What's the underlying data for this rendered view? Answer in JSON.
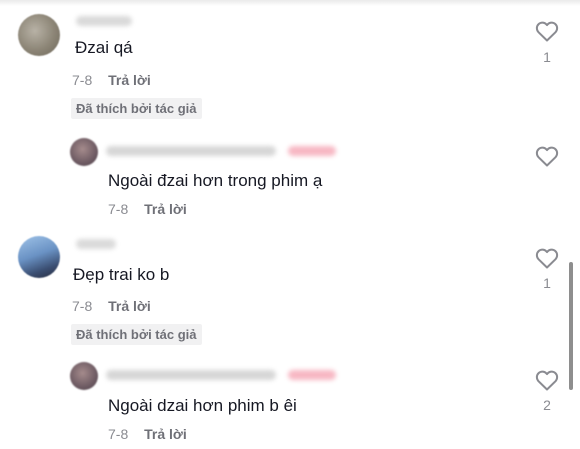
{
  "comments": [
    {
      "text": "Đzai qá",
      "date": "7-8",
      "reply_label": "Trả lời",
      "liked_badge": "Đã thích bởi tác giả",
      "like_count": "1",
      "reply": {
        "text": "Ngoài đzai hơn trong phim ạ",
        "date": "7-8",
        "reply_label": "Trả lời"
      }
    },
    {
      "text": "Đẹp trai ko b",
      "date": "7-8",
      "reply_label": "Trả lời",
      "liked_badge": "Đã thích bởi tác giả",
      "like_count": "1",
      "reply": {
        "text": "Ngoài dzai hơn phim b êi",
        "date": "7-8",
        "reply_label": "Trả lời",
        "like_count": "2"
      }
    }
  ],
  "colors": {
    "text_primary": "#161823",
    "text_secondary": "#8a8b91",
    "badge_bg": "#f1f1f2",
    "author_tag_pink": "#fe2c55"
  },
  "icons": {
    "like": "heart-outline-icon"
  }
}
